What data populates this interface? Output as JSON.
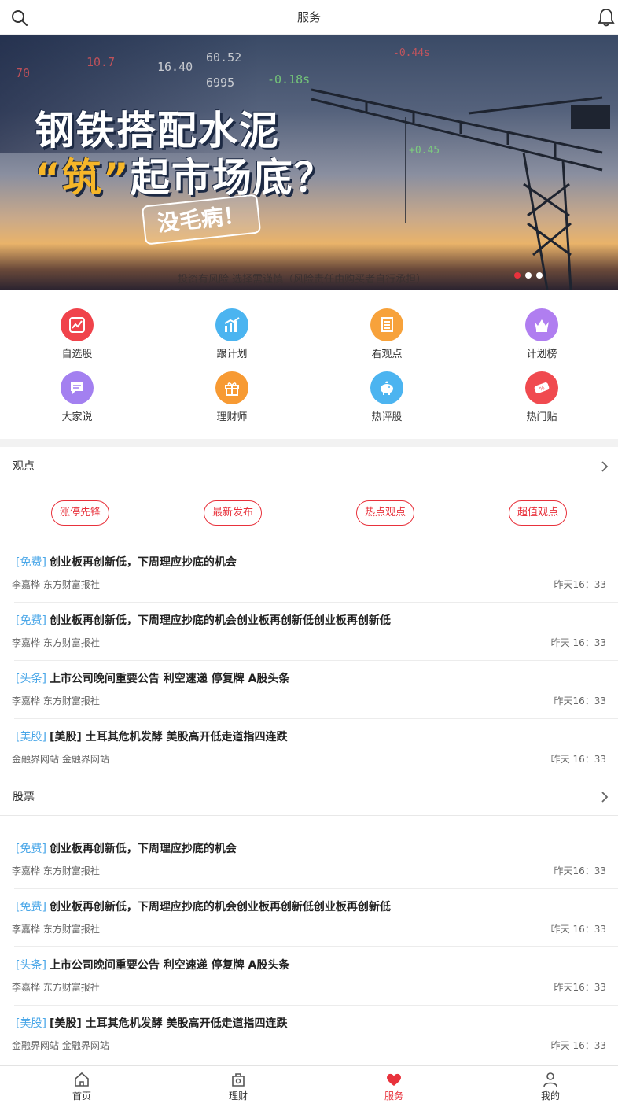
{
  "header": {
    "title": "服务",
    "search_icon": "search-icon",
    "bell_icon": "bell-icon"
  },
  "banner": {
    "line1": "钢铁搭配水泥",
    "line2_quote_open": "“",
    "line2_highlight": "筑",
    "line2_quote_close": "”",
    "line2_rest": "起市场底？",
    "stamp": "没毛病！",
    "disclaimer": "投资有风险 选择需谨慎（风险责任由购买者自行承担）",
    "ticker": [
      "70",
      "10.7",
      "16.40",
      "6995",
      "60.52",
      "-0.18s",
      "-0.44s",
      "+0.45"
    ],
    "slides": 3,
    "active_slide": 0
  },
  "grid": [
    {
      "label": "自选股",
      "icon": "chart-trend-icon",
      "color": "#f0434b"
    },
    {
      "label": "跟计划",
      "icon": "bar-chart-icon",
      "color": "#4bb4f0"
    },
    {
      "label": "看观点",
      "icon": "document-icon",
      "color": "#f7a23b"
    },
    {
      "label": "计划榜",
      "icon": "crown-icon",
      "color": "#b07ef0"
    },
    {
      "label": "大家说",
      "icon": "chat-icon",
      "color": "#a380f0"
    },
    {
      "label": "理财师",
      "icon": "gift-icon",
      "color": "#f79a33"
    },
    {
      "label": "热评股",
      "icon": "piggy-bank-icon",
      "color": "#4cb4f0"
    },
    {
      "label": "热门贴",
      "icon": "coupon-icon",
      "color": "#f04a4f"
    }
  ],
  "section_views": {
    "title": "观点"
  },
  "pills": [
    "涨停先锋",
    "最新发布",
    "热点观点",
    "超值观点"
  ],
  "views_articles": [
    {
      "tag": "[免费]",
      "title": "创业板再创新低，下周理应抄底的机会",
      "source": "李嘉桦 东方财富报社",
      "time": "昨天16：33"
    },
    {
      "tag": "[免费]",
      "title": "创业板再创新低，下周理应抄底的机会创业板再创新低创业板再创新低",
      "source": "李嘉桦 东方财富报社",
      "time": "昨天 16：33"
    },
    {
      "tag": "[头条]",
      "title": "上市公司晚间重要公告 利空速递 停复牌 A股头条",
      "source": "李嘉桦 东方财富报社",
      "time": "昨天16：33"
    },
    {
      "tag": "[美股]",
      "title": "[美股] 土耳其危机发酵 美股高开低走道指四连跌",
      "source": "金融界网站 金融界网站",
      "time": "昨天 16：33"
    }
  ],
  "section_stocks": {
    "title": "股票"
  },
  "stock_articles": [
    {
      "tag": "[免费]",
      "title": "创业板再创新低，下周理应抄底的机会",
      "source": "李嘉桦 东方财富报社",
      "time": "昨天16：33"
    },
    {
      "tag": "[免费]",
      "title": "创业板再创新低，下周理应抄底的机会创业板再创新低创业板再创新低",
      "source": "李嘉桦 东方财富报社",
      "time": "昨天 16：33"
    },
    {
      "tag": "[头条]",
      "title": "上市公司晚间重要公告 利空速递 停复牌 A股头条",
      "source": "李嘉桦 东方财富报社",
      "time": "昨天16：33"
    },
    {
      "tag": "[美股]",
      "title": "[美股] 土耳其危机发酵 美股高开低走道指四连跌",
      "source": "金融界网站 金融界网站",
      "time": "昨天 16：33"
    }
  ],
  "tabbar": [
    {
      "label": "首页",
      "icon": "home-icon",
      "active": false
    },
    {
      "label": "理财",
      "icon": "wallet-icon",
      "active": false
    },
    {
      "label": "服务",
      "icon": "heart-icon",
      "active": true
    },
    {
      "label": "我的",
      "icon": "user-icon",
      "active": false
    }
  ],
  "colors": {
    "accent": "#e8323c",
    "tag": "#4aa7e8",
    "divider": "#ececec"
  }
}
